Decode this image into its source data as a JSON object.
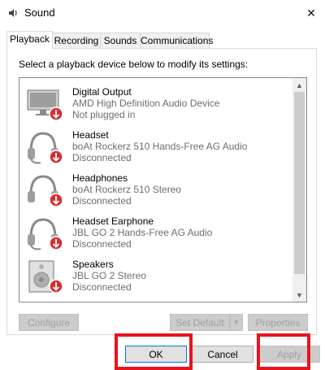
{
  "window": {
    "title": "Sound",
    "close_glyph": "✕"
  },
  "tabs": [
    {
      "label": "Playback",
      "active": true
    },
    {
      "label": "Recording",
      "active": false
    },
    {
      "label": "Sounds",
      "active": false
    },
    {
      "label": "Communications",
      "active": false
    }
  ],
  "playback": {
    "instruction": "Select a playback device below to modify its settings:",
    "devices": [
      {
        "name": "Digital Output",
        "description": "AMD High Definition Audio Device",
        "status": "Not plugged in",
        "icon": "monitor-icon"
      },
      {
        "name": "Headset",
        "description": "boAt Rockerz 510 Hands-Free AG Audio",
        "status": "Disconnected",
        "icon": "headset-icon"
      },
      {
        "name": "Headphones",
        "description": "boAt Rockerz 510 Stereo",
        "status": "Disconnected",
        "icon": "headphones-icon"
      },
      {
        "name": "Headset Earphone",
        "description": "JBL GO 2 Hands-Free AG Audio",
        "status": "Disconnected",
        "icon": "headset-icon"
      },
      {
        "name": "Speakers",
        "description": "JBL GO 2 Stereo",
        "status": "Disconnected",
        "icon": "speaker-icon"
      }
    ],
    "configure_label": "Configure",
    "set_default_label": "Set Default",
    "properties_label": "Properties"
  },
  "footer": {
    "ok_label": "OK",
    "cancel_label": "Cancel",
    "apply_label": "Apply"
  },
  "colors": {
    "highlight": "#e8141c",
    "accent": "#0078d7",
    "disconnected_badge": "#d32f2f"
  }
}
